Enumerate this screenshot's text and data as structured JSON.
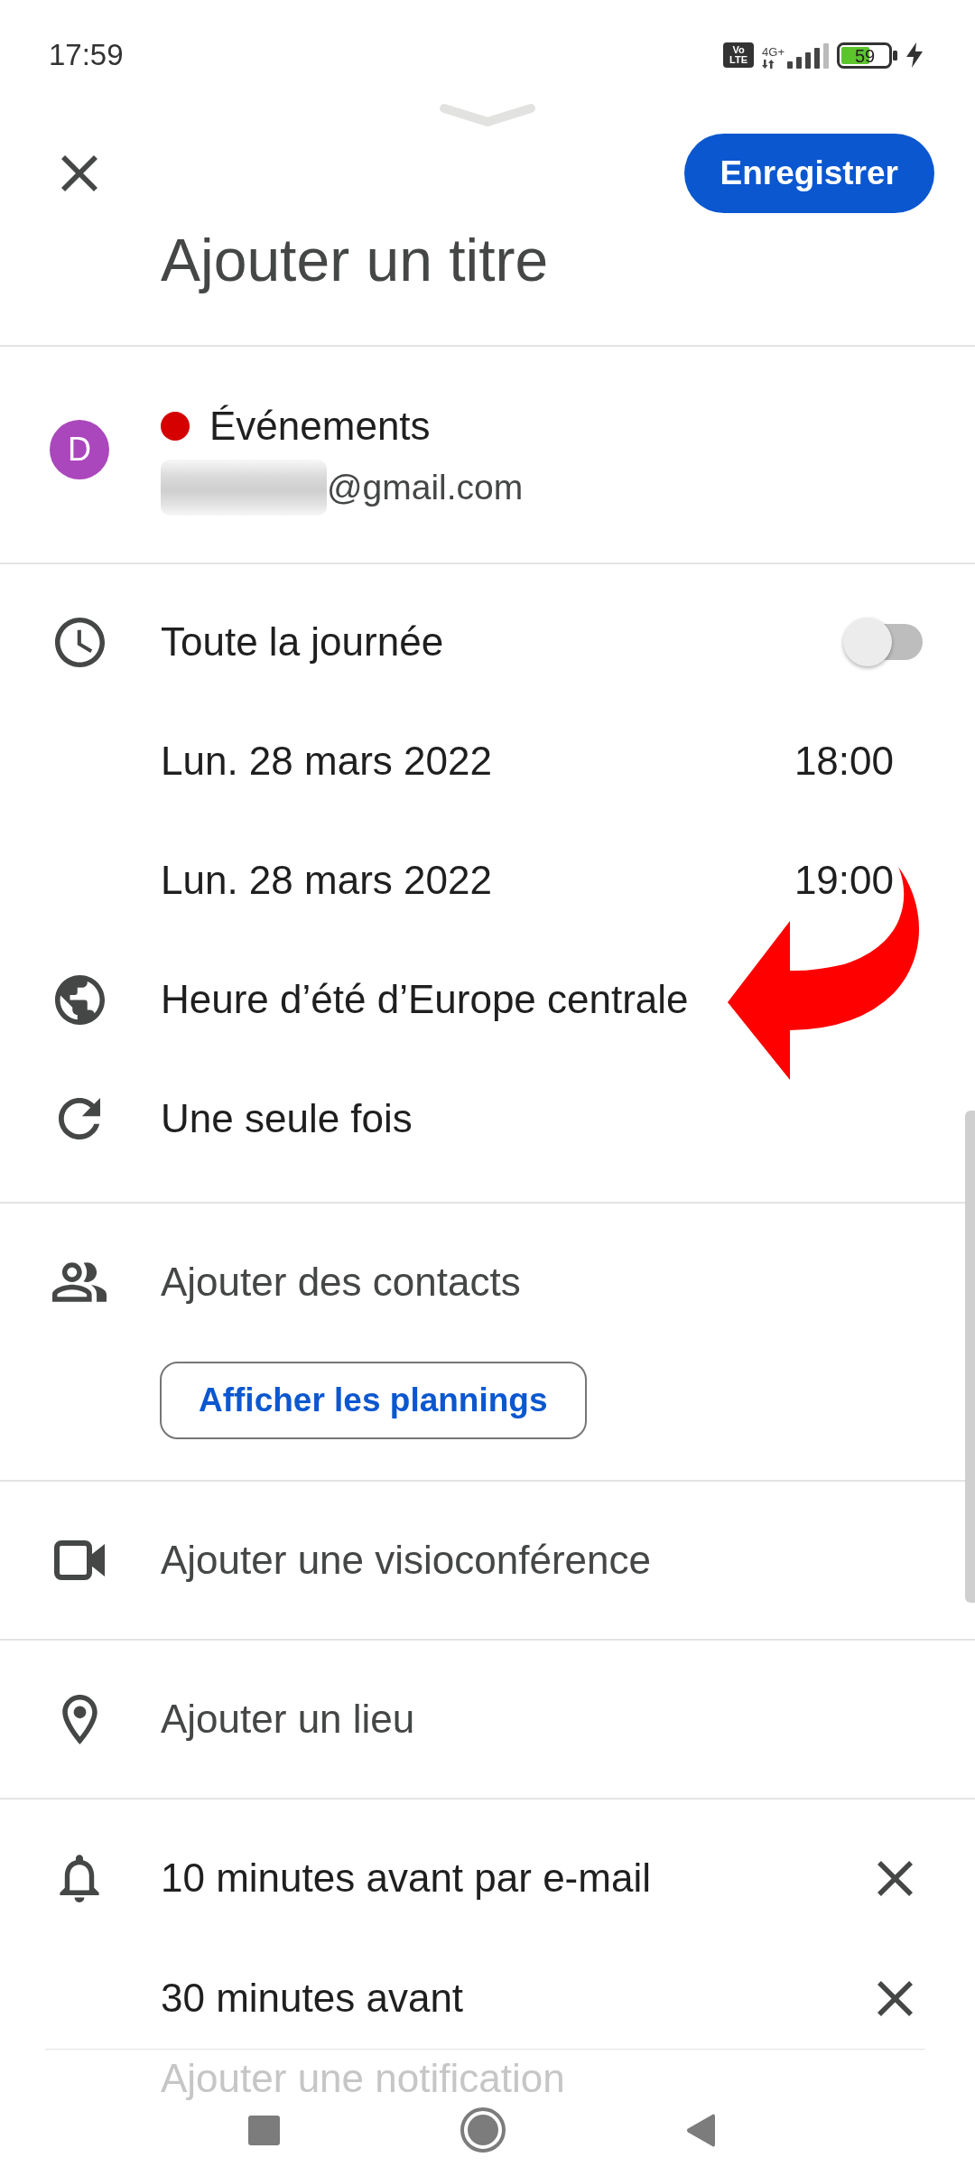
{
  "status_bar": {
    "time": "17:59",
    "volte": "Vo LTE",
    "network": "4G+",
    "battery": "59",
    "charging": true
  },
  "header": {
    "save_button": "Enregistrer",
    "title": {
      "placeholder": "Ajouter un titre"
    }
  },
  "calendar": {
    "avatar_letter": "D",
    "name": "Événements",
    "color": "#d50000",
    "email": "@gmail.com",
    "email_redacted": true
  },
  "time": {
    "all_day": {
      "label": "Toute la journée",
      "on": false
    },
    "start": {
      "date": "Lun. 28 mars 2022",
      "time": "18:00"
    },
    "end": {
      "date": "Lun. 28 mars 2022",
      "time": "19:00"
    },
    "timezone": "Heure d’été d’Europe centrale",
    "recurrence": "Une seule fois"
  },
  "guests": {
    "label": "Ajouter des contacts",
    "button": "Afficher les plannings"
  },
  "conference": {
    "label": "Ajouter une visioconférence"
  },
  "location": {
    "label": "Ajouter un lieu"
  },
  "notifications": {
    "items": [
      {
        "label": "10 minutes avant par e-mail"
      },
      {
        "label": "30 minutes avant"
      }
    ],
    "add_label": "Ajouter une notification"
  },
  "annotations": [
    {
      "kind": "curved-arrow"
    }
  ]
}
